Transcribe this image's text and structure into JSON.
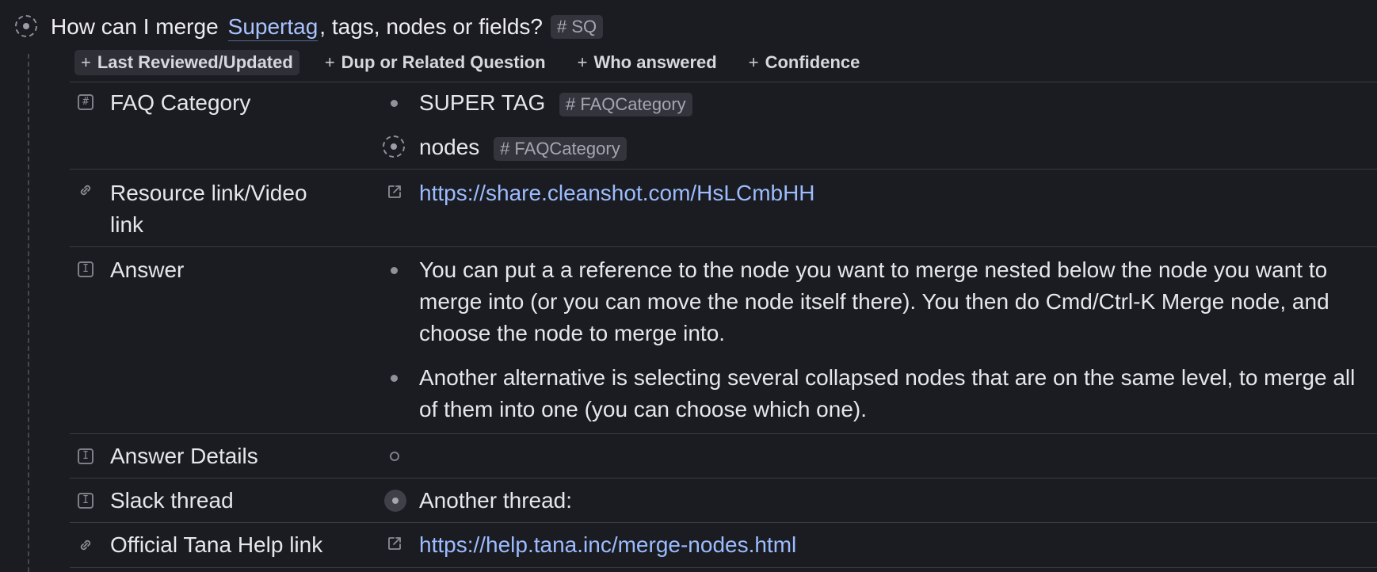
{
  "title": {
    "prefix": "How can I merge",
    "link": "Supertag",
    "suffix": ", tags, nodes or fields?",
    "tag": "# SQ"
  },
  "actions": [
    {
      "label": "Last Reviewed/Updated"
    },
    {
      "label": "Dup or Related Question"
    },
    {
      "label": "Who answered"
    },
    {
      "label": "Confidence"
    }
  ],
  "fields": {
    "faq_category": {
      "label": "FAQ Category",
      "values": [
        {
          "text": "SUPER TAG",
          "tag": "# FAQCategory"
        },
        {
          "text": "nodes",
          "tag": "# FAQCategory"
        }
      ]
    },
    "resource_link": {
      "label_line1": "Resource link/Video",
      "label_line2": "link",
      "url": "https://share.cleanshot.com/HsLCmbHH"
    },
    "answer": {
      "label": "Answer",
      "values": [
        "You can put a a reference to the node you want to merge nested below the node you want to merge into (or you can move the node itself there). You then do Cmd/Ctrl-K Merge node, and choose the node to merge into.",
        "Another alternative is selecting several collapsed nodes that are on the same level, to merge all of them into one (you can choose which one)."
      ]
    },
    "answer_details": {
      "label": "Answer Details"
    },
    "slack_thread": {
      "label": "Slack thread",
      "value": "Another thread:"
    },
    "official_help": {
      "label": "Official Tana Help link",
      "url": "https://help.tana.inc/merge-nodes.html"
    }
  },
  "colors": {
    "background": "#1b1c21",
    "link": "#9cbcff",
    "tag_chip": "#33343c",
    "divider": "#3a3b43"
  }
}
